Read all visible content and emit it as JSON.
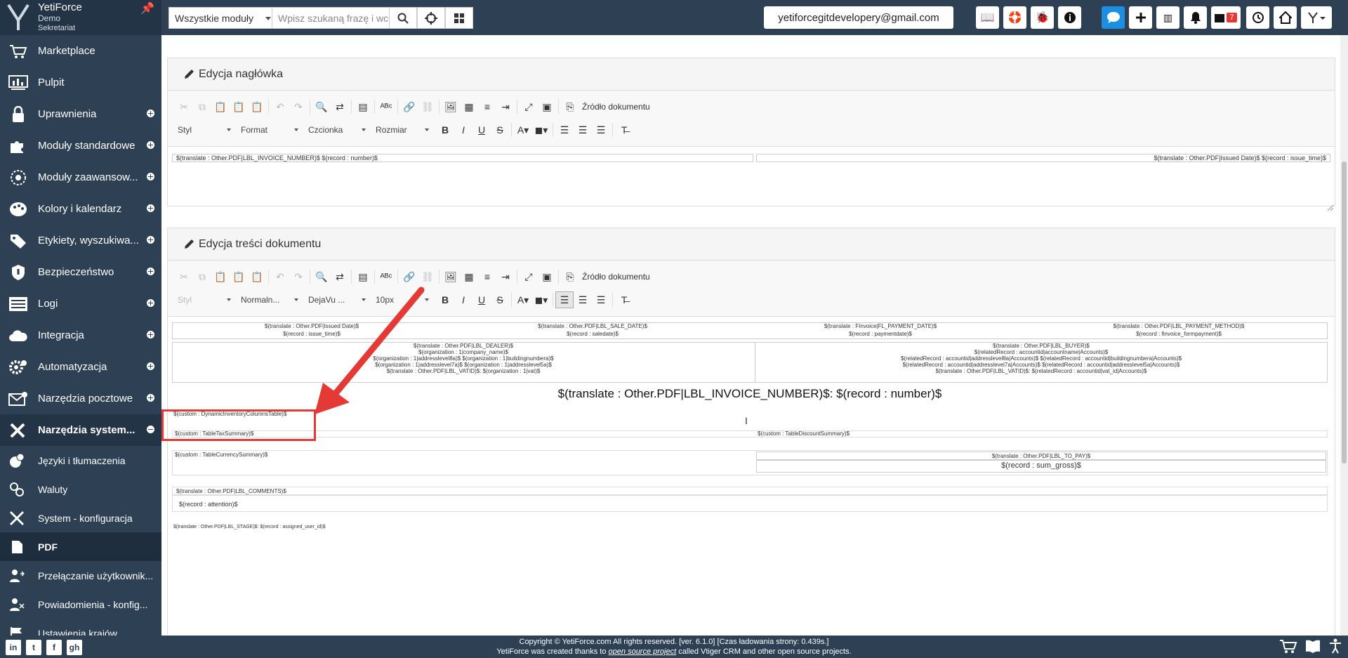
{
  "brand": {
    "name": "YetiForce",
    "subtitle": "Demo",
    "role": "Sekretariat"
  },
  "topbar": {
    "module_select": "Wszystkie moduły",
    "search_placeholder": "Wpisz szukaną frazę i wc",
    "email": "yetiforcegitdevelopery@gmail.com",
    "reminder_count": "7"
  },
  "sidebar": {
    "items": [
      {
        "label": "Marketplace",
        "icon": "cart-icon"
      },
      {
        "label": "Pulpit",
        "icon": "dashboard-icon"
      },
      {
        "label": "Uprawnienia",
        "icon": "lock-icon"
      },
      {
        "label": "Moduły standardowe",
        "icon": "modules-icon"
      },
      {
        "label": "Moduły zaawansow...",
        "icon": "sphere-icon"
      },
      {
        "label": "Kolory i kalendarz",
        "icon": "palette-icon"
      },
      {
        "label": "Etykiety, wyszukiwa...",
        "icon": "tags-icon"
      },
      {
        "label": "Bezpieczeństwo",
        "icon": "shield-icon"
      },
      {
        "label": "Logi",
        "icon": "logs-icon"
      },
      {
        "label": "Integracja",
        "icon": "cloud-icon"
      },
      {
        "label": "Automatyzacja",
        "icon": "gears-icon"
      },
      {
        "label": "Narzędzia pocztowe",
        "icon": "mail-icon"
      },
      {
        "label": "Narzędzia system...",
        "icon": "tools-icon"
      }
    ],
    "subitems": [
      {
        "label": "Języki i tłumaczenia",
        "icon": "language-icon"
      },
      {
        "label": "Waluty",
        "icon": "currency-icon"
      },
      {
        "label": "System - konfiguracja",
        "icon": "wrench-icon"
      },
      {
        "label": "PDF",
        "icon": "pdf-icon"
      },
      {
        "label": "Przełączanie użytkownik...",
        "icon": "switch-user-icon"
      },
      {
        "label": "Powiadomienia - konfig...",
        "icon": "notification-icon"
      },
      {
        "label": "Ustawienia krajów",
        "icon": "flag-icon"
      }
    ]
  },
  "header_panel": {
    "title": "Edycja nagłówka"
  },
  "content_panel": {
    "title": "Edycja treści dokumentu"
  },
  "toolbar": {
    "source_label": "Źródło dokumentu",
    "header_combos": [
      "Styl",
      "Format",
      "Czcionka",
      "Rozmiar"
    ],
    "content_combos": [
      "Styl",
      "Normaln...",
      "DejaVu ...",
      "10px"
    ]
  },
  "header_doc": {
    "left": "$(translate : Other.PDF|LBL_INVOICE_NUMBER)$ $(record : number)$",
    "right": "$(translate : Other.PDF|Issued Date)$ $(record : issue_time)$"
  },
  "content_doc": {
    "row1_labels": [
      "$(translate : Other.PDF|Issued Date)$",
      "$(translate : Other.PDF|LBL_SALE_DATE)$",
      "$(translate : FInvoice|FL_PAYMENT_DATE)$",
      "$(translate : Other.PDF|LBL_PAYMENT_METHOD)$"
    ],
    "row1_values": [
      "$(record : issue_time)$",
      "$(record : saledate)$",
      "$(record : paymentdate)$",
      "$(record : finvoice_formpayment)$"
    ],
    "dealer": [
      "$(translate : Other.PDF|LBL_DEALER)$",
      "$(organization : 1|company_name)$",
      "$(organization : 1|addresslevel8a)$ $(organization : 1|buildingnumbera)$",
      "$(organization : 1|addresslevel7a)$ $(organization : 1|addresslevel5a)$",
      "$(translate : Other.PDF|LBL_VATID)$: $(organization : 1|vat)$"
    ],
    "buyer": [
      "$(translate : Other.PDF|LBL_BUYER)$",
      "$(relatedRecord : accountid|accountname|Accounts)$",
      "$(relatedRecord : accountid|addresslevel8a|Accounts)$ $(relatedRecord : accountid|buildingnumbera|Accounts)$",
      "$(relatedRecord : accountid|addresslevel7a|Accounts)$ $(relatedRecord : accountid|addresslevel5a|Accounts)$",
      "$(translate : Other.PDF|LBL_VATID)$: $(relatedRecord : accountid|vat_id|Accounts)$"
    ],
    "invoice_title": "$(translate : Other.PDF|LBL_INVOICE_NUMBER)$: $(record : number)$",
    "inventory": "$(custom : DynamicInventoryColumnsTable)$",
    "tax_summary": "$(custom : TableTaxSummary)$",
    "discount_summary": "$(custom : TableDiscountSummary)$",
    "currency_summary": "$(custom : TableCurrencySummary)$",
    "to_pay_label": "$(translate : Other.PDF|LBL_TO_PAY)$",
    "to_pay_value": "$(record : sum_gross)$",
    "comments_label": "$(translate : Other.PDF|LBL_COMMENTS)$",
    "comments_value": "$(record : attention)$",
    "stage": "$(translate : Other.PDF|LBL_STAGE)$: $(record : assigned_user_id)$"
  },
  "footer": {
    "line1": "Copyright © YetiForce.com All rights reserved. [ver. 6.1.0] [Czas ładowania strony: 0.439s.]",
    "line2_pre": "YetiForce was created thanks to ",
    "line2_link": "open source project",
    "line2_post": " called Vtiger CRM and other open source projects."
  },
  "colors": {
    "sidebar": "#2d4054",
    "accent": "#1d8fe3",
    "annotation": "#e53935"
  }
}
